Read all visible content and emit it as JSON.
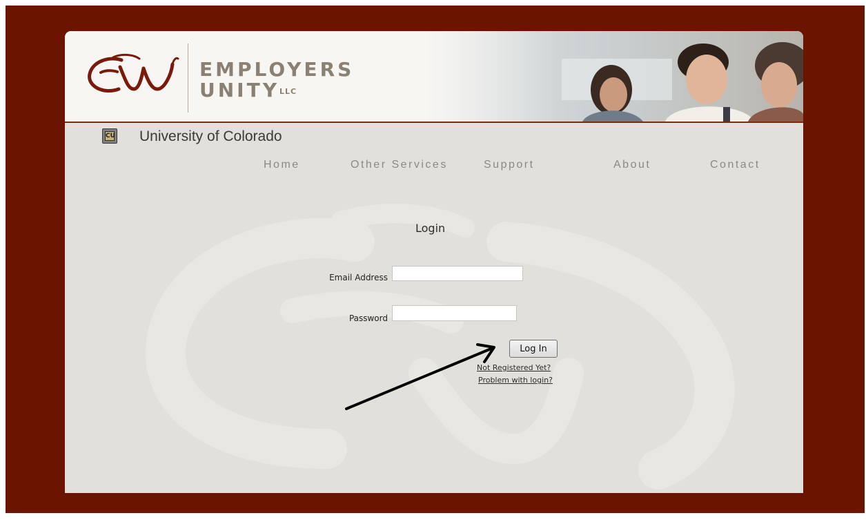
{
  "brand": {
    "logo_mark": "EU",
    "name_line1": "EMPLOYERS",
    "name_line2": "UNITY",
    "suffix": "LLC"
  },
  "institution": {
    "icon": "cu-logo-icon",
    "name": "University of Colorado"
  },
  "nav": {
    "home": "Home",
    "other_services": "Other Services",
    "support": "Support",
    "about": "About",
    "contact": "Contact"
  },
  "login": {
    "title": "Login",
    "email_label": "Email Address",
    "email_value": "",
    "password_label": "Password",
    "password_value": "",
    "submit_label": "Log In",
    "register_link": "Not Registered Yet?",
    "problem_link": "Problem with login?"
  },
  "colors": {
    "frame": "#6b1501",
    "page_bg": "#e2e0da",
    "header_bg": "#f7f6f3",
    "logo_red": "#7a1a0a",
    "brand_text": "#8a8074",
    "nav_text": "#8a8a85"
  }
}
